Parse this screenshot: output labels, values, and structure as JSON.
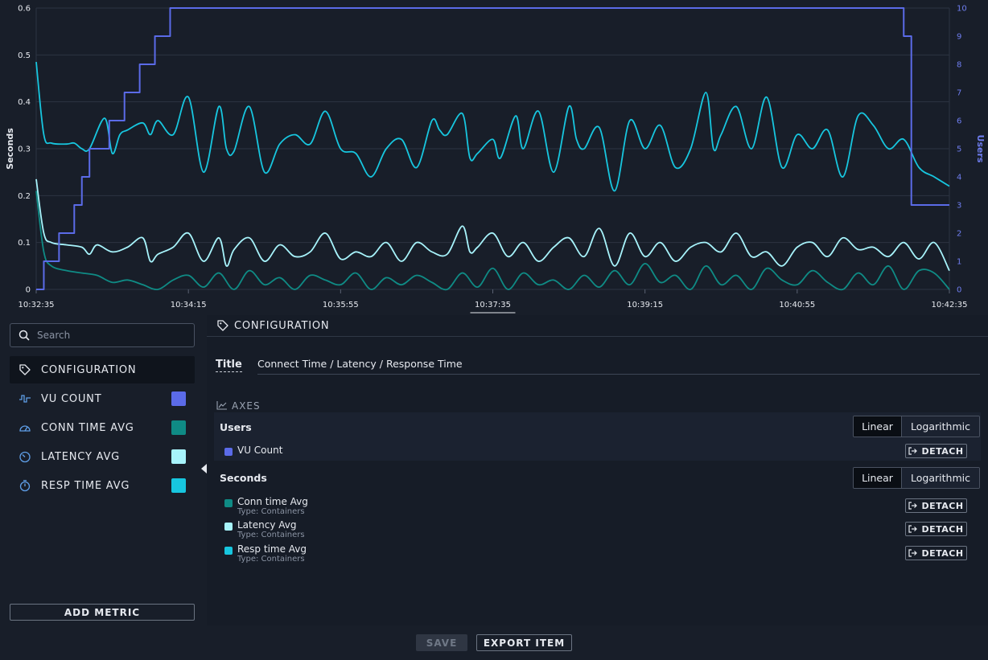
{
  "chart_data": {
    "type": "line",
    "title": "Connect Time / Latency / Response Time",
    "x_ticks": [
      "10:32:35",
      "10:34:15",
      "10:35:55",
      "10:37:35",
      "10:39:15",
      "10:40:55",
      "10:42:35"
    ],
    "x_range": [
      "10:32:35",
      "10:42:35"
    ],
    "y_left": {
      "label": "Seconds",
      "range": [
        0,
        0.6
      ],
      "ticks": [
        "0",
        "0.1",
        "0.2",
        "0.3",
        "0.4",
        "0.5",
        "0.6"
      ]
    },
    "y_right": {
      "label": "Users",
      "range": [
        0,
        10
      ],
      "ticks": [
        "0",
        "1",
        "2",
        "3",
        "4",
        "5",
        "6",
        "7",
        "8",
        "9",
        "10"
      ]
    },
    "grid": true,
    "series": [
      {
        "name": "VU Count",
        "axis": "right",
        "color": "#5b6be8",
        "step": true,
        "points": [
          [
            0,
            0
          ],
          [
            5,
            1
          ],
          [
            15,
            2
          ],
          [
            25,
            3
          ],
          [
            30,
            4
          ],
          [
            35,
            5
          ],
          [
            48,
            6
          ],
          [
            58,
            7
          ],
          [
            68,
            8
          ],
          [
            78,
            9
          ],
          [
            88,
            10
          ],
          [
            565,
            10
          ],
          [
            570,
            9
          ],
          [
            575,
            3
          ],
          [
            600,
            3
          ]
        ]
      },
      {
        "name": "Resp time Avg",
        "axis": "left",
        "color": "#17c6df",
        "points": [
          [
            0,
            0.485
          ],
          [
            5,
            0.33
          ],
          [
            10,
            0.312
          ],
          [
            20,
            0.31
          ],
          [
            25,
            0.312
          ],
          [
            30,
            0.3
          ],
          [
            35,
            0.3
          ],
          [
            45,
            0.365
          ],
          [
            50,
            0.29
          ],
          [
            55,
            0.33
          ],
          [
            60,
            0.34
          ],
          [
            70,
            0.355
          ],
          [
            75,
            0.33
          ],
          [
            80,
            0.36
          ],
          [
            90,
            0.33
          ],
          [
            100,
            0.41
          ],
          [
            110,
            0.25
          ],
          [
            120,
            0.39
          ],
          [
            125,
            0.3
          ],
          [
            130,
            0.295
          ],
          [
            140,
            0.39
          ],
          [
            150,
            0.25
          ],
          [
            160,
            0.31
          ],
          [
            170,
            0.33
          ],
          [
            180,
            0.31
          ],
          [
            190,
            0.38
          ],
          [
            200,
            0.3
          ],
          [
            210,
            0.29
          ],
          [
            220,
            0.24
          ],
          [
            230,
            0.3
          ],
          [
            240,
            0.32
          ],
          [
            250,
            0.26
          ],
          [
            260,
            0.36
          ],
          [
            265,
            0.34
          ],
          [
            270,
            0.33
          ],
          [
            280,
            0.375
          ],
          [
            285,
            0.28
          ],
          [
            290,
            0.29
          ],
          [
            300,
            0.32
          ],
          [
            305,
            0.28
          ],
          [
            315,
            0.37
          ],
          [
            320,
            0.3
          ],
          [
            330,
            0.38
          ],
          [
            340,
            0.25
          ],
          [
            350,
            0.39
          ],
          [
            355,
            0.32
          ],
          [
            360,
            0.3
          ],
          [
            370,
            0.345
          ],
          [
            380,
            0.21
          ],
          [
            390,
            0.36
          ],
          [
            400,
            0.3
          ],
          [
            410,
            0.35
          ],
          [
            420,
            0.26
          ],
          [
            430,
            0.3
          ],
          [
            440,
            0.42
          ],
          [
            445,
            0.3
          ],
          [
            450,
            0.33
          ],
          [
            460,
            0.39
          ],
          [
            470,
            0.3
          ],
          [
            480,
            0.41
          ],
          [
            490,
            0.26
          ],
          [
            500,
            0.33
          ],
          [
            510,
            0.3
          ],
          [
            520,
            0.34
          ],
          [
            530,
            0.24
          ],
          [
            540,
            0.37
          ],
          [
            550,
            0.35
          ],
          [
            560,
            0.3
          ],
          [
            570,
            0.32
          ],
          [
            580,
            0.26
          ],
          [
            590,
            0.24
          ],
          [
            600,
            0.22
          ]
        ]
      },
      {
        "name": "Latency Avg",
        "axis": "left",
        "color": "#a7f3fb",
        "points": [
          [
            0,
            0.235
          ],
          [
            5,
            0.12
          ],
          [
            10,
            0.1
          ],
          [
            20,
            0.095
          ],
          [
            30,
            0.09
          ],
          [
            35,
            0.075
          ],
          [
            40,
            0.095
          ],
          [
            50,
            0.08
          ],
          [
            60,
            0.09
          ],
          [
            70,
            0.11
          ],
          [
            75,
            0.06
          ],
          [
            80,
            0.075
          ],
          [
            90,
            0.09
          ],
          [
            100,
            0.12
          ],
          [
            110,
            0.06
          ],
          [
            120,
            0.11
          ],
          [
            125,
            0.05
          ],
          [
            130,
            0.085
          ],
          [
            140,
            0.11
          ],
          [
            150,
            0.06
          ],
          [
            160,
            0.095
          ],
          [
            170,
            0.07
          ],
          [
            180,
            0.08
          ],
          [
            190,
            0.12
          ],
          [
            200,
            0.065
          ],
          [
            210,
            0.08
          ],
          [
            220,
            0.07
          ],
          [
            230,
            0.1
          ],
          [
            240,
            0.06
          ],
          [
            250,
            0.1
          ],
          [
            260,
            0.08
          ],
          [
            270,
            0.075
          ],
          [
            280,
            0.135
          ],
          [
            285,
            0.08
          ],
          [
            290,
            0.09
          ],
          [
            300,
            0.12
          ],
          [
            310,
            0.07
          ],
          [
            320,
            0.1
          ],
          [
            330,
            0.06
          ],
          [
            340,
            0.09
          ],
          [
            350,
            0.11
          ],
          [
            360,
            0.07
          ],
          [
            370,
            0.13
          ],
          [
            380,
            0.05
          ],
          [
            390,
            0.12
          ],
          [
            400,
            0.07
          ],
          [
            410,
            0.1
          ],
          [
            420,
            0.06
          ],
          [
            430,
            0.09
          ],
          [
            440,
            0.1
          ],
          [
            450,
            0.08
          ],
          [
            460,
            0.12
          ],
          [
            470,
            0.07
          ],
          [
            480,
            0.08
          ],
          [
            490,
            0.05
          ],
          [
            500,
            0.09
          ],
          [
            510,
            0.1
          ],
          [
            520,
            0.07
          ],
          [
            530,
            0.11
          ],
          [
            540,
            0.085
          ],
          [
            550,
            0.09
          ],
          [
            560,
            0.07
          ],
          [
            570,
            0.1
          ],
          [
            580,
            0.065
          ],
          [
            590,
            0.1
          ],
          [
            600,
            0.04
          ]
        ]
      },
      {
        "name": "Conn time Avg",
        "axis": "left",
        "color": "#0f8b85",
        "points": [
          [
            0,
            0.21
          ],
          [
            5,
            0.08
          ],
          [
            10,
            0.05
          ],
          [
            20,
            0.04
          ],
          [
            30,
            0.035
          ],
          [
            40,
            0.03
          ],
          [
            50,
            0.015
          ],
          [
            60,
            0.02
          ],
          [
            70,
            0.01
          ],
          [
            80,
            0.0
          ],
          [
            90,
            0.02
          ],
          [
            100,
            0.03
          ],
          [
            110,
            0.005
          ],
          [
            120,
            0.035
          ],
          [
            130,
            0.0
          ],
          [
            140,
            0.04
          ],
          [
            150,
            0.01
          ],
          [
            160,
            0.025
          ],
          [
            170,
            0.0
          ],
          [
            180,
            0.03
          ],
          [
            190,
            0.02
          ],
          [
            200,
            0.01
          ],
          [
            210,
            0.035
          ],
          [
            220,
            0.0
          ],
          [
            230,
            0.025
          ],
          [
            240,
            0.01
          ],
          [
            250,
            0.03
          ],
          [
            260,
            0.015
          ],
          [
            270,
            0.0
          ],
          [
            280,
            0.035
          ],
          [
            290,
            0.005
          ],
          [
            300,
            0.045
          ],
          [
            310,
            0.0
          ],
          [
            320,
            0.035
          ],
          [
            330,
            0.01
          ],
          [
            340,
            0.02
          ],
          [
            350,
            0.0
          ],
          [
            360,
            0.03
          ],
          [
            370,
            0.005
          ],
          [
            380,
            0.04
          ],
          [
            390,
            0.01
          ],
          [
            400,
            0.055
          ],
          [
            410,
            0.015
          ],
          [
            420,
            0.03
          ],
          [
            430,
            0.0
          ],
          [
            440,
            0.05
          ],
          [
            450,
            0.01
          ],
          [
            460,
            0.03
          ],
          [
            470,
            0.0
          ],
          [
            480,
            0.045
          ],
          [
            490,
            0.02
          ],
          [
            500,
            0.01
          ],
          [
            510,
            0.04
          ],
          [
            520,
            0.015
          ],
          [
            530,
            0.0
          ],
          [
            540,
            0.035
          ],
          [
            550,
            0.01
          ],
          [
            560,
            0.05
          ],
          [
            570,
            0.0
          ],
          [
            580,
            0.04
          ],
          [
            590,
            0.035
          ],
          [
            600,
            0.0
          ]
        ]
      }
    ]
  },
  "sidebar": {
    "search_placeholder": "Search",
    "items": [
      {
        "label": "CONFIGURATION",
        "icon": "tag-icon"
      },
      {
        "label": "VU COUNT",
        "icon": "pulse-icon",
        "color": "#5b6be8"
      },
      {
        "label": "CONN TIME AVG",
        "icon": "gauge-icon",
        "color": "#0f8b85"
      },
      {
        "label": "LATENCY AVG",
        "icon": "timer-icon",
        "color": "#a7f3fb"
      },
      {
        "label": "RESP TIME AVG",
        "icon": "stopwatch-icon",
        "color": "#17c6df"
      }
    ],
    "add_metric": "ADD METRIC"
  },
  "panel": {
    "header": "CONFIGURATION",
    "title_label": "Title",
    "title_value": "Connect Time / Latency / Response Time",
    "axes_label": "AXES",
    "axis_groups": [
      {
        "name": "Users",
        "scale_options": [
          "Linear",
          "Logarithmic"
        ],
        "selected": "Linear",
        "metrics": [
          {
            "name": "VU Count",
            "type": "",
            "color": "#5b6be8"
          }
        ]
      },
      {
        "name": "Seconds",
        "scale_options": [
          "Linear",
          "Logarithmic"
        ],
        "selected": "Linear",
        "metrics": [
          {
            "name": "Conn time Avg",
            "type": "Type: Containers",
            "color": "#0f8b85"
          },
          {
            "name": "Latency Avg",
            "type": "Type: Containers",
            "color": "#a7f3fb"
          },
          {
            "name": "Resp time Avg",
            "type": "Type: Containers",
            "color": "#17c6df"
          }
        ]
      }
    ],
    "detach_label": "DETACH"
  },
  "footer": {
    "save_label": "SAVE",
    "export_label": "EXPORT ITEM"
  }
}
